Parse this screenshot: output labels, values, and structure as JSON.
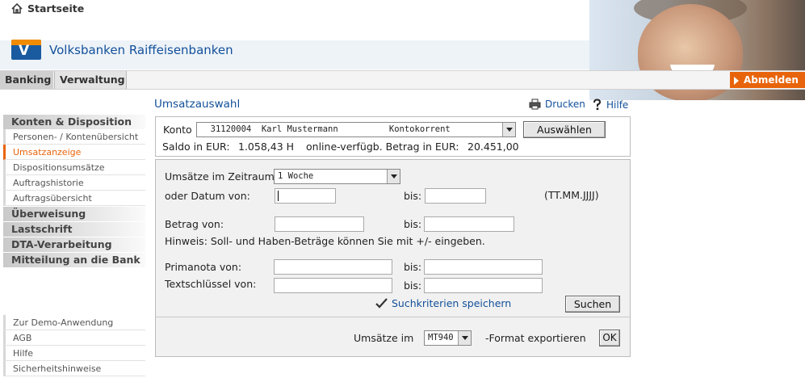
{
  "header": {
    "home_label": "Startseite",
    "bank_name": "Volksbanken Raiffeisenbanken",
    "logo_text": "V"
  },
  "nav": {
    "tabs": [
      "Banking",
      "Verwaltung"
    ],
    "logout_label": "Abmelden"
  },
  "sidebar": {
    "groups": [
      {
        "label": "Konten & Disposition",
        "items": [
          "Personen- / Kontenübersicht",
          "Umsatzanzeige",
          "Dispositionsumsätze",
          "Auftragshistorie",
          "Auftragsübersicht"
        ]
      },
      {
        "label": "Überweisung"
      },
      {
        "label": "Lastschrift"
      },
      {
        "label": "DTA-Verarbeitung"
      },
      {
        "label": "Mitteilung an die Bank"
      }
    ],
    "active_item": "Umsatzanzeige",
    "footer_items": [
      "Zur Demo-Anwendung",
      "AGB",
      "Hilfe",
      "Sicherheitshinweise"
    ]
  },
  "main": {
    "title": "Umsatzauswahl",
    "print_label": "Drucken",
    "help_label": "Hilfe",
    "account": {
      "label": "Konto",
      "selected": "  31120004  Karl Mustermann          Kontokorrent",
      "select_button": "Auswählen",
      "balance_label": "Saldo in EUR:",
      "balance_value": "1.058,43 H",
      "available_label": "online-verfügb. Betrag in EUR:",
      "available_value": "20.451,00"
    },
    "filter": {
      "period_label": "Umsätze im Zeitraum",
      "period_value": "1 Woche",
      "date_from_label": "oder Datum von:",
      "to_label": "bis:",
      "date_format_hint": "(TT.MM.JJJJ)",
      "amount_from_label": "Betrag von:",
      "hint": "Hinweis: Soll- und Haben-Beträge können Sie mit +/- eingeben.",
      "primanota_label": "Primanota von:",
      "textkey_label": "Textschlüssel von:",
      "save_criteria_label": "Suchkriterien speichern",
      "search_button": "Suchen"
    },
    "export": {
      "label_prefix": "Umsätze im",
      "format_value": "MT940",
      "label_suffix": "-Format exportieren",
      "ok_button": "OK"
    }
  },
  "colors": {
    "accent": "#e8640c",
    "brand_blue": "#12509a",
    "logo_orange": "#f18b00"
  }
}
